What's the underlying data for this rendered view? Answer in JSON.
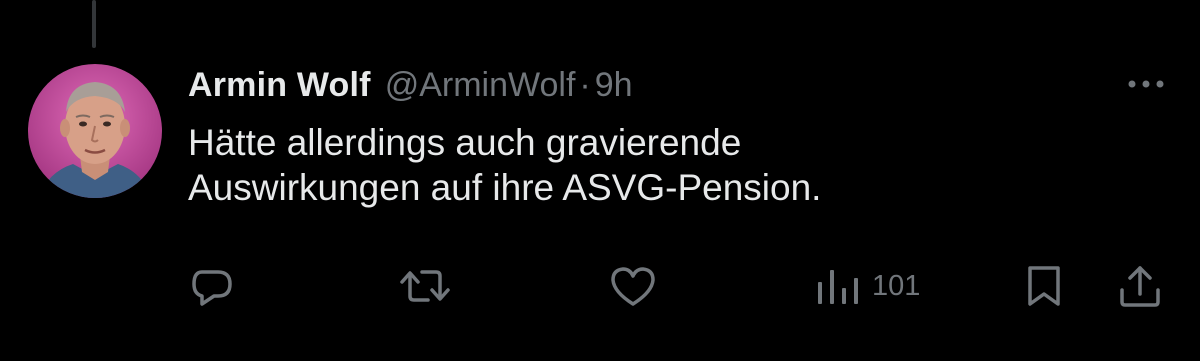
{
  "tweet": {
    "author_name": "Armin Wolf",
    "handle": "@ArminWolf",
    "separator": "·",
    "time": "9h",
    "text": "Hätte allerdings auch gravierende\nAuswirkungen auf ihre ASVG-Pension."
  },
  "actions": {
    "reply_icon": "reply-bubble-icon",
    "retweet_icon": "retweet-icon",
    "like_icon": "heart-icon",
    "views_icon": "bar-chart-icon",
    "views_count": "101",
    "bookmark_icon": "bookmark-icon",
    "share_icon": "share-icon"
  },
  "colors": {
    "background": "#000000",
    "text_primary": "#e7e9ea",
    "text_secondary": "#71767b",
    "avatar_background": "#c24b9a"
  }
}
